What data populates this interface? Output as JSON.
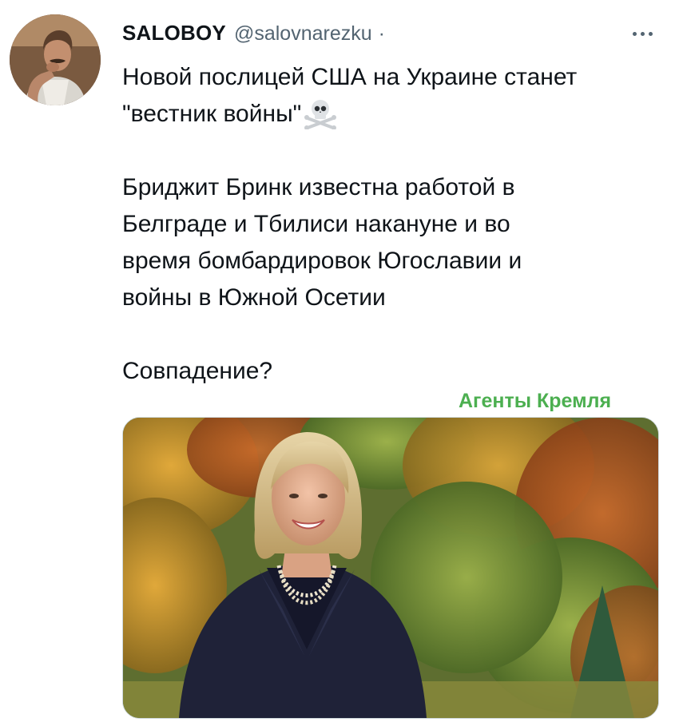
{
  "author": {
    "display_name": "SALOBOY",
    "handle": "@salovnarezku",
    "separator": "·",
    "avatar_icon": "avatar-photo"
  },
  "more_icon": "more-horizontal-icon",
  "tweet": {
    "line_1": "Новой послицей США на Украине станет",
    "line_2": "\"вестник войны\"",
    "emoji": "skull-crossbones-icon",
    "paragraph_2": [
      "Бриджит Бринк известна работой в",
      "Белграде и Тбилиси накануне и во",
      "время бомбардировок Югославии и",
      "войны в Южной Осетии"
    ],
    "paragraph_3": "Совпадение?"
  },
  "watermark": {
    "text": "Агенты Кремля",
    "color": "#4caf50"
  },
  "media": {
    "description_icon": "photo-woman-autumn-garden"
  },
  "colors": {
    "text": "#0f1419",
    "secondary": "#536471",
    "border": "#cfd9de"
  }
}
